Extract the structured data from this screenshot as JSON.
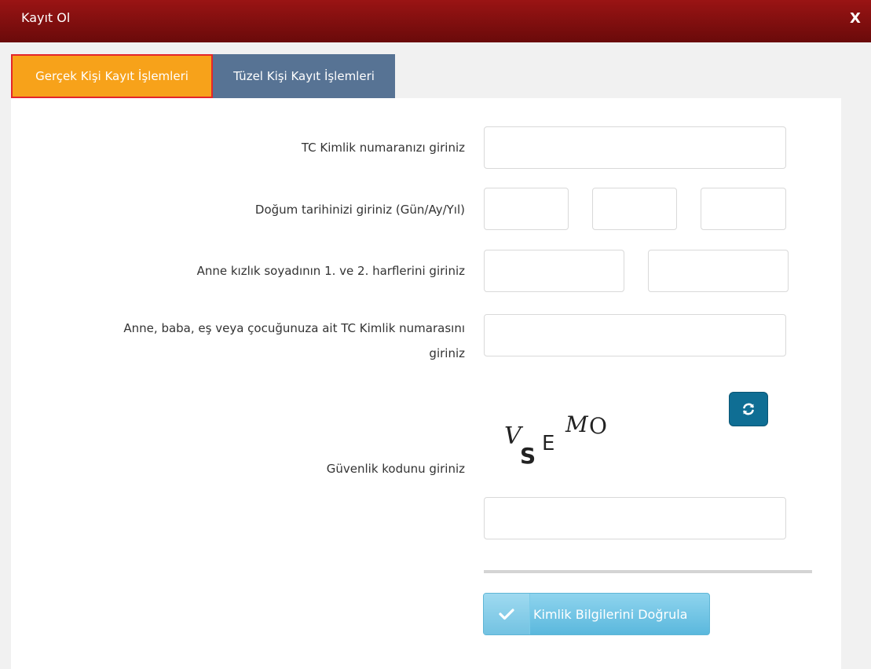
{
  "window": {
    "title": "Kayıt Ol",
    "close_label": "X"
  },
  "tabs": [
    {
      "label": "Gerçek Kişi Kayıt İşlemleri",
      "active": true
    },
    {
      "label": "Tüzel Kişi Kayıt İşlemleri",
      "active": false
    }
  ],
  "form": {
    "tc_label": "TC Kimlik numaranızı giriniz",
    "tc_value": "",
    "birth_label": "Doğum tarihinizi giriniz (Gün/Ay/Yıl)",
    "birth_day": "",
    "birth_month": "",
    "birth_year": "",
    "mother_label": "Anne kızlık soyadının 1. ve 2. harflerini giriniz",
    "mother_letter1": "",
    "mother_letter2": "",
    "relative_label_line1": "Anne, baba, eş veya çocuğunuza ait TC Kimlik numarasını",
    "relative_label_line2": "giriniz",
    "relative_tc_value": "",
    "security_label": "Güvenlik kodunu giriniz",
    "security_value": "",
    "captcha_chars": [
      "V",
      "S",
      "E",
      "M",
      "O"
    ],
    "verify_button": "Kimlik Bilgilerini Doğrula"
  },
  "colors": {
    "titlebar": "#8a1010",
    "tab_active": "#f7a21a",
    "tab_active_border": "#e4262a",
    "tab_inactive": "#577394",
    "refresh_button": "#0f6e94",
    "verify_button": "#6cc3e4"
  },
  "icons": {
    "refresh": "refresh-icon",
    "check": "check-icon"
  }
}
